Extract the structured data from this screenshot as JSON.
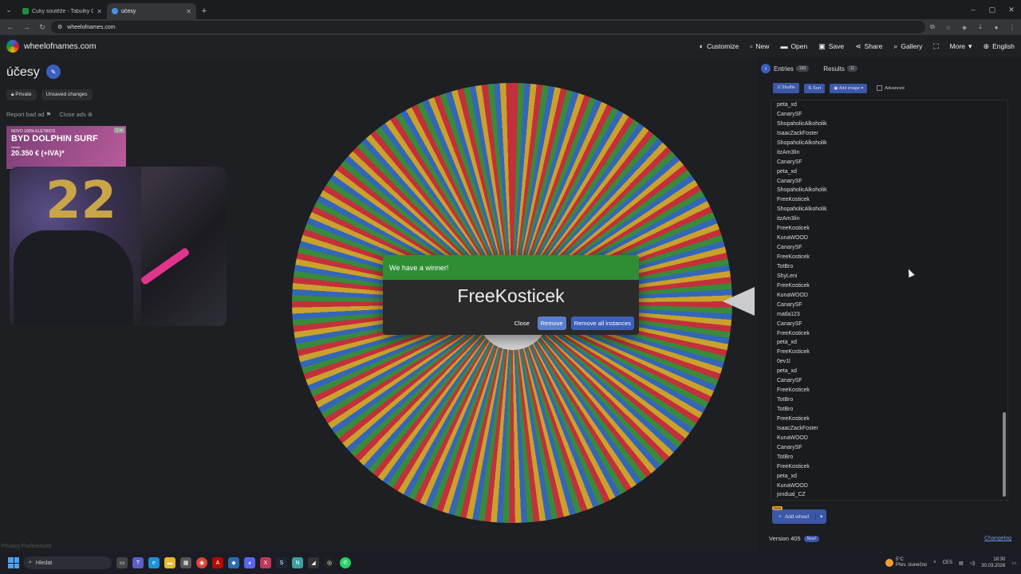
{
  "browser": {
    "tabs": [
      {
        "title": "Cuky soutěže - Tabulky Google",
        "active": false,
        "favicon_color": "#1e8e3e"
      },
      {
        "title": "účesy",
        "active": true,
        "favicon_color": "#4a90e2"
      }
    ],
    "url": "wheelofnames.com"
  },
  "header": {
    "brand": "wheelofnames.com",
    "menu": [
      {
        "label": "Customize",
        "icon": "palette-icon"
      },
      {
        "label": "New",
        "icon": "new-file-icon"
      },
      {
        "label": "Open",
        "icon": "folder-icon"
      },
      {
        "label": "Save",
        "icon": "save-icon"
      },
      {
        "label": "Share",
        "icon": "share-icon"
      },
      {
        "label": "Gallery",
        "icon": "search-icon"
      },
      {
        "label": "More",
        "icon": "fullscreen-icon"
      },
      {
        "label": "English",
        "icon": "globe-icon"
      }
    ]
  },
  "left": {
    "wheel_title": "účesy",
    "privacy_badge": "Private",
    "unsaved_badge": "Unsaved changes",
    "report_ad": "Report bad ad",
    "close_ads": "Close ads",
    "ad": {
      "line1": "NOVO 100% ELÉTRICO",
      "line2": "BYD DOLPHIN SURF",
      "line3": "Desde",
      "line4": "20.350 € (+IVA)*"
    },
    "balloon_text": "22",
    "privacy_prefs": "Privacy Preferences"
  },
  "dialog": {
    "title": "We have a winner!",
    "winner": "FreeKosticek",
    "close": "Close",
    "remove": "Remove",
    "remove_all": "Remove all instances"
  },
  "right": {
    "entries_tab": "Entries",
    "entries_count": "190",
    "results_tab": "Results",
    "results_count": "11",
    "shuffle": "Shuffle",
    "sort": "Sort",
    "add_image": "Add image",
    "advanced": "Advanced",
    "entries": [
      "peta_xd",
      "CanarySF",
      "ShopaholicAlkoholik",
      "IsaacZackFoster",
      "ShopaholicAlkoholik",
      "itzAm3lin",
      "CanarySF",
      "peta_xd",
      "CanarySF",
      "ShopaholicAlkoholik",
      "FreeKosticek",
      "ShopaholicAlkoholik",
      "itzAm3lin",
      "FreeKosticek",
      "KunaWOOD",
      "CanarySF",
      "FreeKosticek",
      "TotBro",
      "ShyLeni",
      "FreeKosticek",
      "KunaWOOD",
      "CanarySF",
      "matla123",
      "CanarySF",
      "FreeKosticek",
      "peta_xd",
      "FreeKosticek",
      "0ev1l",
      "peta_xd",
      "CanarySF",
      "FreeKosticek",
      "TotBro",
      "TotBro",
      "FreeKosticek",
      "IsaacZackFoster",
      "KunaWOOD",
      "CanarySF",
      "TotBro",
      "FreeKosticek",
      "peta_xd",
      "KunaWOOD",
      "jondual_CZ"
    ],
    "beta": "Beta",
    "add_wheel": "Add wheel",
    "version": "Version 405",
    "new_badge": "New!",
    "changelog": "Changelog"
  },
  "taskbar": {
    "search": "Hledat",
    "temp": "5°C",
    "weather": "Přev. slunečno",
    "lang": "CES",
    "time": "18:30",
    "date": "30.03.2026"
  }
}
